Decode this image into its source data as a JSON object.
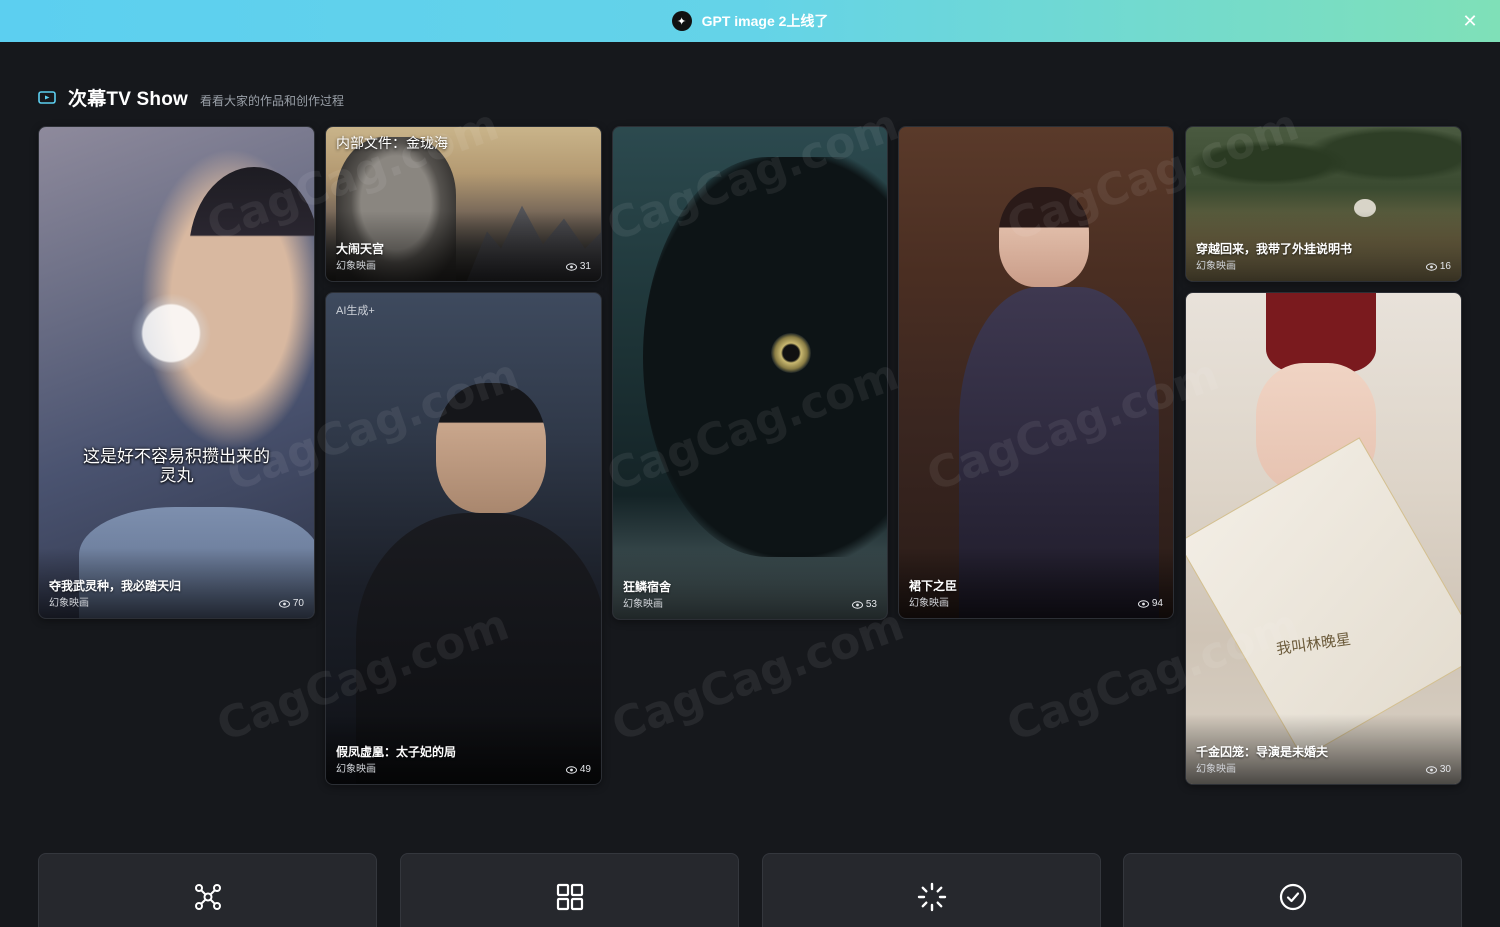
{
  "banner": {
    "text": "GPT image 2上线了"
  },
  "section": {
    "title": "次幕TV Show",
    "subtitle": "看看大家的作品和创作过程"
  },
  "cards": [
    {
      "title": "夺我武灵种，我必踏天归",
      "studio": "幻象映画",
      "views": "70",
      "caption": "这是好不容易积攒出来的灵丸"
    },
    {
      "title": "大闹天宫",
      "studio": "幻象映画",
      "views": "31",
      "tag": "内部文件：金珑海"
    },
    {
      "title": "假凤虚凰：太子妃的局",
      "studio": "幻象映画",
      "views": "49",
      "tag": "AI生成+"
    },
    {
      "title": "狂鳞宿舍",
      "studio": "幻象映画",
      "views": "53"
    },
    {
      "title": "裙下之臣",
      "studio": "幻象映画",
      "views": "94"
    },
    {
      "title": "穿越回来，我带了外挂说明书",
      "studio": "幻象映画",
      "views": "16"
    },
    {
      "title": "千金囚笼：导演是未婚夫",
      "studio": "幻象映画",
      "views": "30",
      "invite": "我叫林晚星"
    }
  ],
  "watermark": "CagCag.com",
  "icons": [
    "sparkle-icon",
    "close-icon",
    "tv-icon",
    "eye-icon",
    "nodes-icon",
    "grid-icon",
    "loader-icon",
    "check-circle-icon"
  ]
}
